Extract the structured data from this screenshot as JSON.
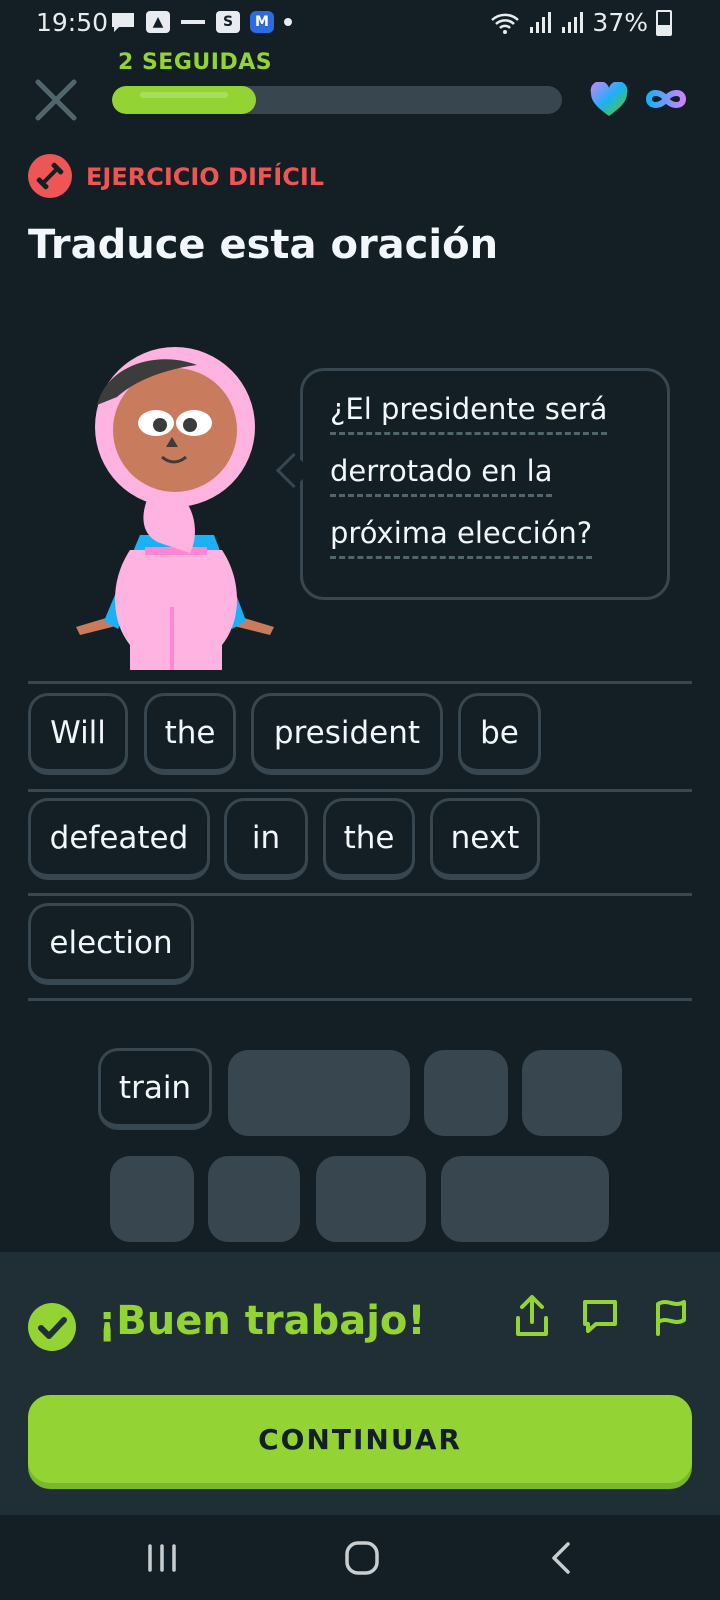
{
  "status_bar": {
    "time": "19:50",
    "battery": "37%",
    "icons": [
      "message-icon",
      "app-icon-a",
      "news-icon",
      "s-app-icon",
      "m-app-icon",
      "dot-icon"
    ]
  },
  "lesson": {
    "streak": "2 SEGUIDAS",
    "progress": 0.32,
    "hearts": "infinity-icon",
    "tag": "EJERCICIO DIFÍCIL",
    "prompt": "Traduce esta oración"
  },
  "bubble": {
    "line1": "¿El presidente será",
    "line2": "derrotado en la",
    "line3": "próxima elección?"
  },
  "answer": {
    "words": [
      "Will",
      "the",
      "president",
      "be",
      "defeated",
      "in",
      "the",
      "next",
      "election"
    ]
  },
  "word_bank": {
    "remaining": [
      "train"
    ]
  },
  "feedback": {
    "message": "¡Buen trabajo!",
    "button": "CONTINUAR"
  },
  "colors": {
    "background": "#131f24",
    "accent_green": "#93d333",
    "tag_red": "#ee5555",
    "border": "#37464f"
  }
}
